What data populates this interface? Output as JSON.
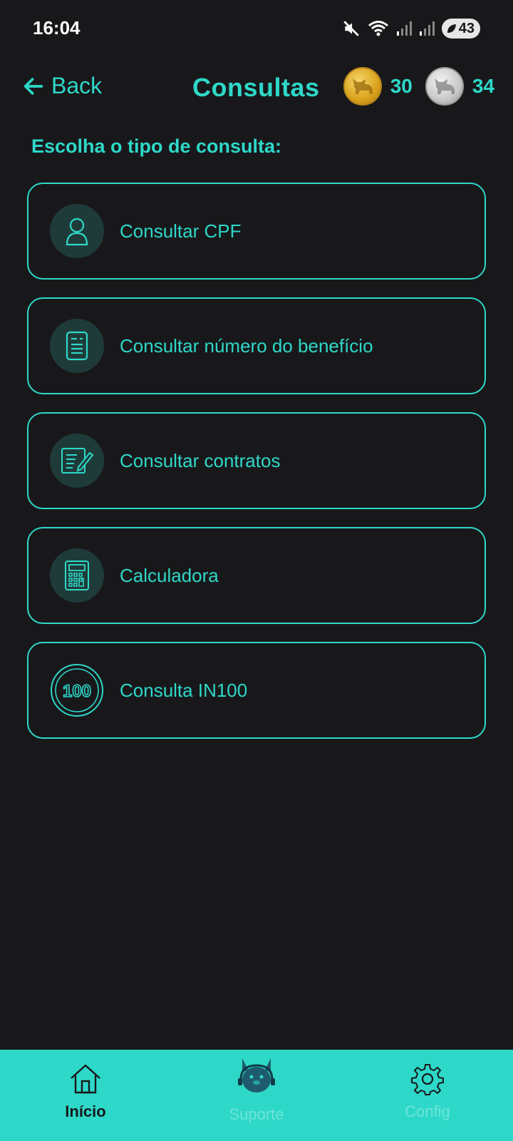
{
  "status_bar": {
    "time": "16:04",
    "battery": "43"
  },
  "header": {
    "back_label": "Back",
    "title": "Consultas",
    "gold_coins": "30",
    "silver_coins": "34"
  },
  "subtitle": "Escolha o tipo de consulta:",
  "options": [
    {
      "label": "Consultar CPF",
      "icon": "user-icon"
    },
    {
      "label": "Consultar número do benefício",
      "icon": "document-icon"
    },
    {
      "label": "Consultar contratos",
      "icon": "contract-edit-icon"
    },
    {
      "label": "Calculadora",
      "icon": "calculator-icon"
    },
    {
      "label": "Consulta IN100",
      "icon": "in100-icon"
    }
  ],
  "bottom_nav": [
    {
      "label": "Início",
      "icon": "home-icon",
      "active": true
    },
    {
      "label": "Suporte",
      "icon": "support-dog-icon",
      "active": false
    },
    {
      "label": "Config",
      "icon": "gear-icon",
      "active": false
    }
  ],
  "colors": {
    "accent": "#2ed8c8",
    "background": "#18181b",
    "icon_circle": "#1f3b39"
  }
}
